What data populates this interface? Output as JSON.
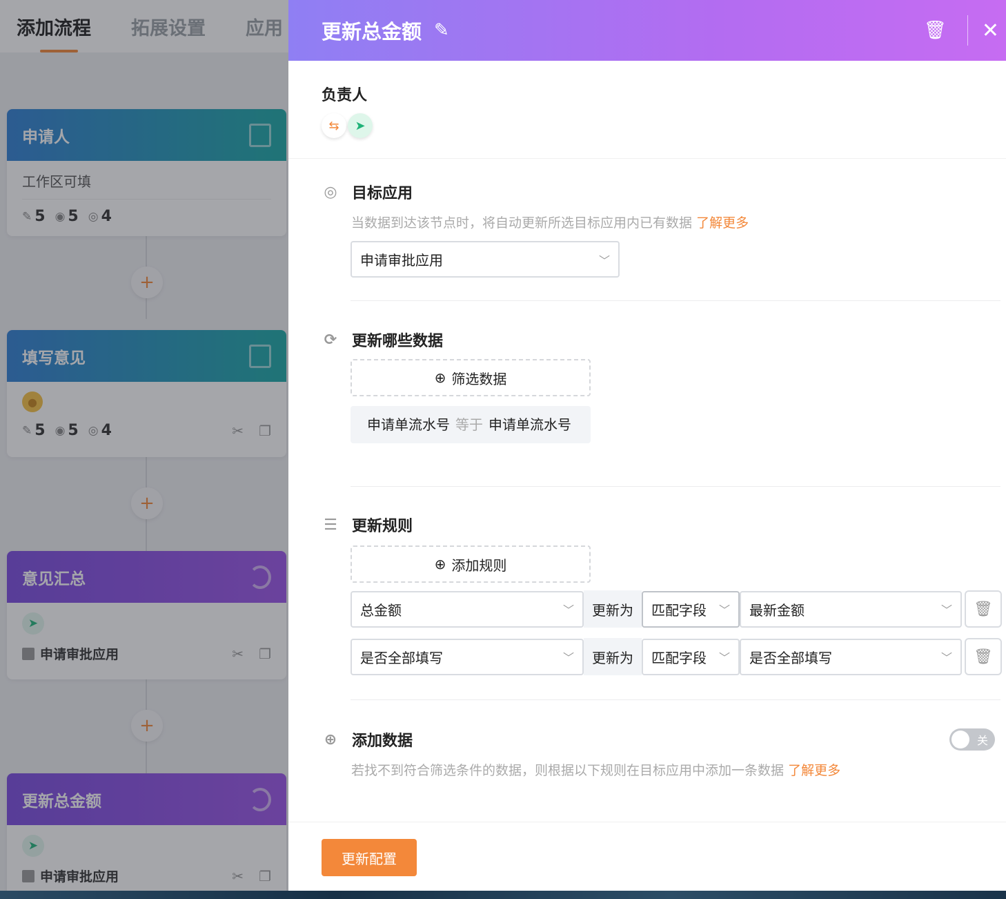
{
  "tabs": {
    "add_flow": "添加流程",
    "extend": "拓展设置",
    "app": "应用"
  },
  "nodes": [
    {
      "title": "申请人",
      "subtitle": "工作区可填",
      "edit": "5",
      "hidden": "5",
      "view": "4"
    },
    {
      "title": "填写意见",
      "edit": "5",
      "hidden": "5",
      "view": "4"
    },
    {
      "title": "意见汇总",
      "app": "申请审批应用"
    },
    {
      "title": "更新总金额",
      "app": "申请审批应用"
    }
  ],
  "plus": "+",
  "drawer": {
    "title": "更新总金额",
    "owner_label": "负责人",
    "target": {
      "title": "目标应用",
      "desc": "当数据到达该节点时，将自动更新所选目标应用内已有数据",
      "link": "了解更多",
      "value": "申请审批应用"
    },
    "which": {
      "title": "更新哪些数据",
      "filter_btn": "筛选数据",
      "cond_field": "申请单流水号",
      "cond_op": "等于",
      "cond_value": "申请单流水号"
    },
    "rules": {
      "title": "更新规则",
      "add_btn": "添加规则",
      "items": [
        {
          "field": "总金额",
          "label": "更新为",
          "mode": "匹配字段",
          "value": "最新金额"
        },
        {
          "field": "是否全部填写",
          "label": "更新为",
          "mode": "匹配字段",
          "value": "是否全部填写"
        }
      ]
    },
    "add_data": {
      "title": "添加数据",
      "desc": "若找不到符合筛选条件的数据，则根据以下规则在目标应用中添加一条数据",
      "link": "了解更多",
      "toggle": "关"
    },
    "submit": "更新配置"
  }
}
